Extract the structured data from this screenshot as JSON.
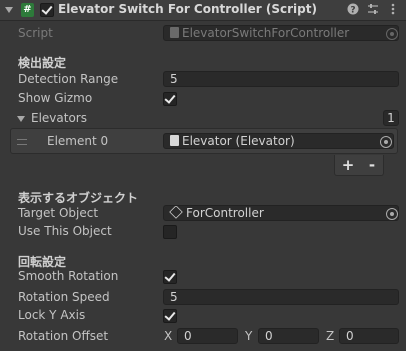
{
  "header": {
    "title": "Elevator Switch For Controller (Script)",
    "script_glyph": "#",
    "enabled": true,
    "icons": [
      "help-icon",
      "presets-icon",
      "more-icon"
    ]
  },
  "script_row": {
    "label": "Script",
    "value": "ElevatorSwitchForController"
  },
  "detection": {
    "section": "検出設定",
    "range_label": "Detection Range",
    "range_value": "5",
    "gizmo_label": "Show Gizmo",
    "gizmo_checked": true
  },
  "elevators": {
    "label": "Elevators",
    "count": "1",
    "items": [
      {
        "label": "Element 0",
        "value": "Elevator (Elevator)"
      }
    ],
    "add_label": "+",
    "remove_label": "-"
  },
  "display": {
    "section": "表示するオブジェクト",
    "target_label": "Target Object",
    "target_value": "ForController",
    "use_this_label": "Use This Object",
    "use_this_checked": false
  },
  "rotation": {
    "section": "回転設定",
    "smooth_label": "Smooth Rotation",
    "smooth_checked": true,
    "speed_label": "Rotation Speed",
    "speed_value": "5",
    "lock_label": "Lock Y Axis",
    "lock_checked": true,
    "offset_label": "Rotation Offset",
    "x_label": "X",
    "x_value": "0",
    "y_label": "Y",
    "y_value": "0",
    "z_label": "Z",
    "z_value": "0"
  },
  "colors": {
    "background": "#383838",
    "field": "#2a2a2a",
    "text": "#c4c4c4"
  }
}
